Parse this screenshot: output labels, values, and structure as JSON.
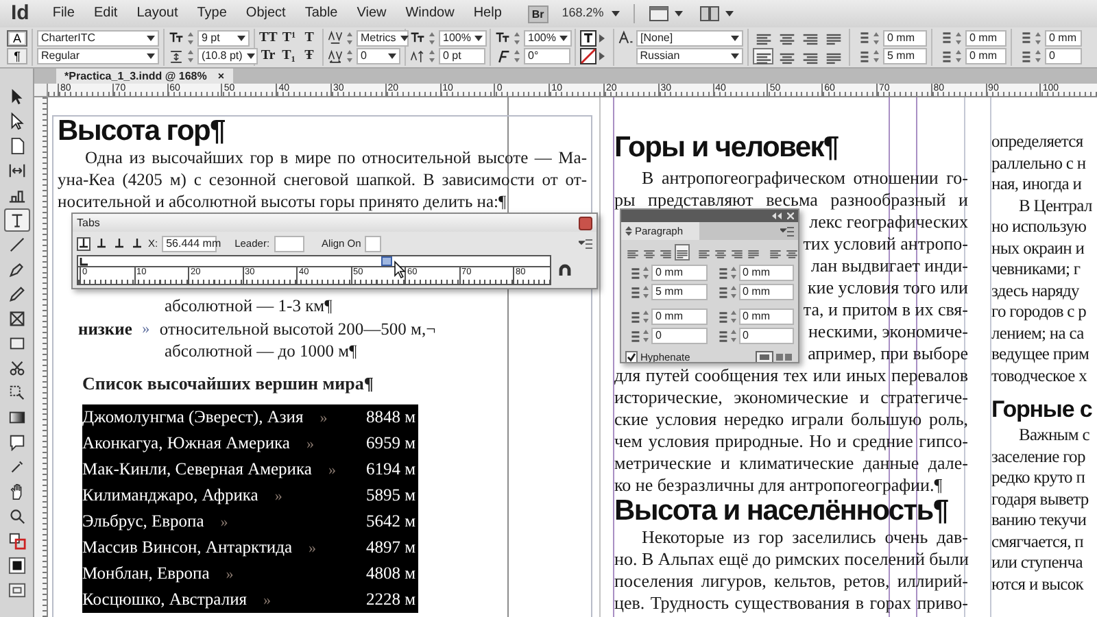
{
  "menu_bar": {
    "app_logo": "Id",
    "items": [
      "File",
      "Edit",
      "Layout",
      "Type",
      "Object",
      "Table",
      "View",
      "Window",
      "Help"
    ],
    "bridge_button": "Br",
    "zoom": "168.2%"
  },
  "control_panel": {
    "mode_buttons": [
      {
        "label": "A",
        "selected": true
      },
      {
        "label": "¶",
        "selected": false
      }
    ],
    "font_family": "CharterITC",
    "font_style": "Regular",
    "font_size": "9 pt",
    "leading": "(10.8 pt)",
    "case_buttons": [
      "TT",
      "T¹",
      "T"
    ],
    "position_buttons": [
      "Tr",
      "T₁",
      "Ŧ"
    ],
    "kerning": "Metrics",
    "tracking": "0",
    "vertical_scale": "100%",
    "baseline_shift": "0 pt",
    "horizontal_scale": "100%",
    "skew": "0°",
    "character_style": "[None]",
    "language": "Russian",
    "alignment_buttons": [
      {
        "selected": false
      },
      {
        "selected": false
      },
      {
        "selected": false
      },
      {
        "selected": false
      },
      {
        "selected": true
      },
      {
        "selected": false
      },
      {
        "selected": false
      },
      {
        "selected": false
      }
    ],
    "left_indent": "0 mm",
    "first_line_indent": "5 mm",
    "right_indent": "0 mm",
    "last_line_indent": "0 mm",
    "space_before": "0 mm",
    "drop_cap_lines": "0"
  },
  "document_tab": {
    "title": "*Practica_1_3.indd @ 168%",
    "close": "×"
  },
  "ruler_labels": [
    "80",
    "70",
    "60",
    "50",
    "40",
    "30",
    "20",
    "10",
    "0",
    "10",
    "20",
    "30",
    "40",
    "50",
    "60",
    "70",
    "80",
    "90",
    "100"
  ],
  "tools": [
    {
      "kind": "arrow",
      "selected": false
    },
    {
      "kind": "hollow-arrow",
      "selected": false
    },
    {
      "kind": "page",
      "selected": false
    },
    {
      "kind": "gap",
      "selected": false
    },
    {
      "kind": "collector",
      "selected": false
    },
    {
      "kind": "type",
      "selected": true
    },
    {
      "kind": "line",
      "selected": false
    },
    {
      "kind": "pen",
      "selected": false
    },
    {
      "kind": "pencil",
      "selected": false
    },
    {
      "kind": "frame",
      "selected": false
    },
    {
      "kind": "rect",
      "selected": false
    },
    {
      "kind": "scissors",
      "selected": false
    },
    {
      "kind": "transform",
      "selected": false
    },
    {
      "kind": "gradient",
      "selected": false
    },
    {
      "kind": "note",
      "selected": false
    },
    {
      "kind": "eyedropper",
      "selected": false
    },
    {
      "kind": "hand",
      "selected": false
    },
    {
      "kind": "zoom",
      "selected": false
    },
    {
      "kind": "fillstroke",
      "selected": false
    },
    {
      "kind": "square",
      "selected": false
    },
    {
      "kind": "screen",
      "selected": false
    }
  ],
  "left_page": {
    "heading": "Высота гор¶",
    "lines": [
      {
        "text": "Одна из высочайших гор в мире по относительной высоте — Ма-",
        "kind": "indent-justify"
      },
      {
        "text": "уна-Кеа (4205 м) с сезонной снеговой шапкой. В зависимости от от-",
        "kind": "justify"
      },
      {
        "text": "носительной и абсолютной высоты горы принято делить на:¶",
        "kind": "left"
      }
    ],
    "classes": [
      {
        "text": "абсолютной — 1-3 км¶"
      },
      {
        "term": "низкие",
        "marker": "»",
        "text": "относительной высотой 200—500 м,¬"
      },
      {
        "text": "абсолютной — до 1000 м¶"
      }
    ],
    "list_title": "Список высочайших вершин мира¶",
    "peaks": [
      {
        "name": "Джомолунгма (Эверест), Азия",
        "marker": "»",
        "height": "8848 м"
      },
      {
        "name": "Аконкагуа, Южная Америка",
        "marker": "»",
        "height": "6959 м"
      },
      {
        "name": "Мак-Кинли, Северная Америка",
        "marker": "»",
        "height": "6194 м"
      },
      {
        "name": "Килиманджаро, Африка",
        "marker": "»",
        "height": "5895 м"
      },
      {
        "name": "Эльбрус, Европа",
        "marker": "»",
        "height": "5642 м"
      },
      {
        "name": "Массив Винсон, Антарктида",
        "marker": "»",
        "height": "4897 м"
      },
      {
        "name": "Монблан, Европа",
        "marker": "»",
        "height": "4808 м"
      },
      {
        "name": "Косцюшко, Австралия",
        "marker": "»",
        "height": "2228 м"
      }
    ]
  },
  "right_column_1": [
    {
      "kind": "heading",
      "text": "Горы и человек¶"
    },
    {
      "kind": "indent-justify",
      "text": "В антропогеографическом отношении го-"
    },
    {
      "kind": "justify",
      "text": "ры представляют весьма разнообразный и"
    },
    {
      "kind": "right",
      "text": "лекс географических"
    },
    {
      "kind": "right",
      "text": "тих условий антропо-"
    },
    {
      "kind": "right",
      "text": "лан выдвигает инди-"
    },
    {
      "kind": "right",
      "text": "кие условия того или"
    },
    {
      "kind": "right",
      "text": "та, и притом в их свя-"
    },
    {
      "kind": "right",
      "text": "нескими, экономиче-"
    },
    {
      "kind": "right",
      "text": "апример, при выборе"
    },
    {
      "kind": "justify",
      "text": "для путей сообщения тех или иных перевалов"
    },
    {
      "kind": "justify",
      "text": "исторические, экономические и стратегиче-"
    },
    {
      "kind": "justify",
      "text": "ские условия нередко играли большую роль,"
    },
    {
      "kind": "justify",
      "text": "чем условия природные. Но и средние гипсо-"
    },
    {
      "kind": "justify",
      "text": "метрические и климатические данные дале-"
    },
    {
      "kind": "left",
      "text": "ко не безразличны для антропогеографии.¶"
    },
    {
      "kind": "heading",
      "text": "Высота и населённость¶"
    },
    {
      "kind": "indent-justify",
      "text": "Некоторые из гор заселились очень дав-"
    },
    {
      "kind": "justify",
      "text": "но. В Альпах ещё до римских поселений были"
    },
    {
      "kind": "justify",
      "text": "поселения лигуров, кельтов, ретов, иллирий-"
    },
    {
      "kind": "justify",
      "text": "цев. Трудность существования в горах приво-"
    }
  ],
  "right_column_2": [
    {
      "kind": "left",
      "text": "определяется"
    },
    {
      "kind": "left",
      "text": "раллельно с н"
    },
    {
      "kind": "left",
      "text": "ная, иногда и"
    },
    {
      "kind": "indent-left",
      "text": "В Централ"
    },
    {
      "kind": "left",
      "text": "но использую"
    },
    {
      "kind": "left",
      "text": "ных окраин и"
    },
    {
      "kind": "left",
      "text": "чевниками; г"
    },
    {
      "kind": "left",
      "text": "здесь наряду"
    },
    {
      "kind": "left",
      "text": "го городов с р"
    },
    {
      "kind": "left",
      "text": "лением; на са"
    },
    {
      "kind": "left",
      "text": "ведущее прим"
    },
    {
      "kind": "left",
      "text": "товодческое х"
    },
    {
      "kind": "heading",
      "text": "Горные с"
    },
    {
      "kind": "indent-left",
      "text": "Важным с"
    },
    {
      "kind": "left",
      "text": "заселение гор"
    },
    {
      "kind": "left",
      "text": "редко круто п"
    },
    {
      "kind": "left",
      "text": "годаря выветр"
    },
    {
      "kind": "left",
      "text": "ванию текучи"
    },
    {
      "kind": "left",
      "text": "смягчается, п"
    },
    {
      "kind": "left",
      "text": "или ступенча"
    },
    {
      "kind": "left",
      "text": "ются и высок"
    }
  ],
  "tabs_panel": {
    "title": "Tabs",
    "tab_type_buttons": [
      {
        "selected": true
      },
      {
        "selected": false
      },
      {
        "selected": false
      },
      {
        "selected": false
      }
    ],
    "x_label": "X:",
    "x_value": "56.444 mm",
    "leader_label": "Leader:",
    "align_on_label": "Align On",
    "ruler_labels": [
      "0",
      "10",
      "20",
      "30",
      "40",
      "50",
      "60",
      "70",
      "80"
    ]
  },
  "paragraph_panel": {
    "title": "Paragraph",
    "alignment_buttons": [
      {
        "selected": false
      },
      {
        "selected": false
      },
      {
        "selected": false
      },
      {
        "selected": true
      },
      {
        "selected": false
      },
      {
        "selected": false
      },
      {
        "selected": false
      },
      {
        "selected": false
      },
      {
        "selected": false
      },
      {
        "selected": false
      }
    ],
    "fields": [
      [
        "0 mm",
        "0 mm"
      ],
      [
        "5 mm",
        "0 mm"
      ],
      [
        "0 mm",
        "0 mm"
      ],
      [
        "0",
        "0"
      ]
    ],
    "hyphenate": {
      "label": "Hyphenate",
      "checked": true
    }
  }
}
